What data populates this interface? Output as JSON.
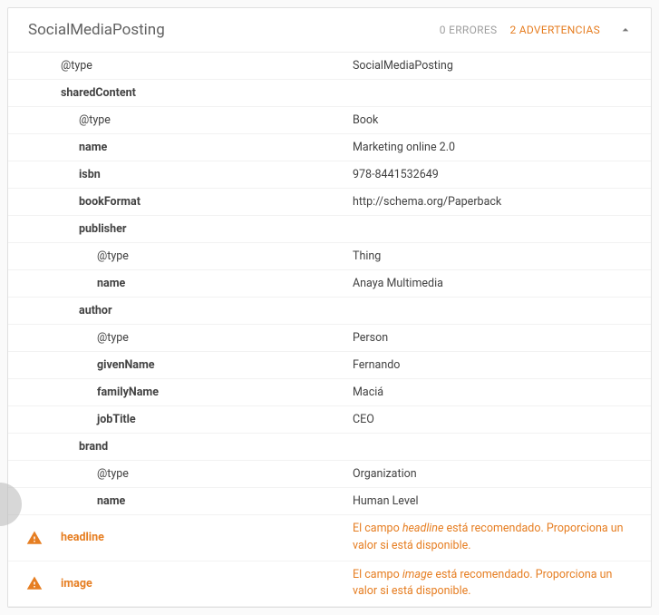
{
  "header": {
    "title": "SocialMediaPosting",
    "errors": "0 ERRORES",
    "warnings": "2 ADVERTENCIAS"
  },
  "rows": [
    {
      "key": "@type",
      "val": "SocialMediaPosting",
      "indent": 1,
      "bold": false
    },
    {
      "key": "sharedContent",
      "val": "",
      "indent": 1,
      "bold": true
    },
    {
      "key": "@type",
      "val": "Book",
      "indent": 2,
      "bold": false
    },
    {
      "key": "name",
      "val": "Marketing online 2.0",
      "indent": 2,
      "bold": true
    },
    {
      "key": "isbn",
      "val": "978-8441532649",
      "indent": 2,
      "bold": true
    },
    {
      "key": "bookFormat",
      "val": "http://schema.org/Paperback",
      "indent": 2,
      "bold": true
    },
    {
      "key": "publisher",
      "val": "",
      "indent": 2,
      "bold": true
    },
    {
      "key": "@type",
      "val": "Thing",
      "indent": 3,
      "bold": false
    },
    {
      "key": "name",
      "val": "Anaya Multimedia",
      "indent": 3,
      "bold": true
    },
    {
      "key": "author",
      "val": "",
      "indent": 2,
      "bold": true
    },
    {
      "key": "@type",
      "val": "Person",
      "indent": 3,
      "bold": false
    },
    {
      "key": "givenName",
      "val": "Fernando",
      "indent": 3,
      "bold": true
    },
    {
      "key": "familyName",
      "val": "Maciá",
      "indent": 3,
      "bold": true
    },
    {
      "key": "jobTitle",
      "val": "CEO",
      "indent": 3,
      "bold": true
    },
    {
      "key": "brand",
      "val": "",
      "indent": 2,
      "bold": true
    },
    {
      "key": "@type",
      "val": "Organization",
      "indent": 3,
      "bold": false
    },
    {
      "key": "name",
      "val": "Human Level",
      "indent": 3,
      "bold": true
    }
  ],
  "warningsList": [
    {
      "key": "headline",
      "em": "headline",
      "pre": "El campo ",
      "post": " está recomendado. Proporciona un valor si está disponible."
    },
    {
      "key": "image",
      "em": "image",
      "pre": "El campo ",
      "post": " está recomendado. Proporciona un valor si está disponible."
    }
  ]
}
